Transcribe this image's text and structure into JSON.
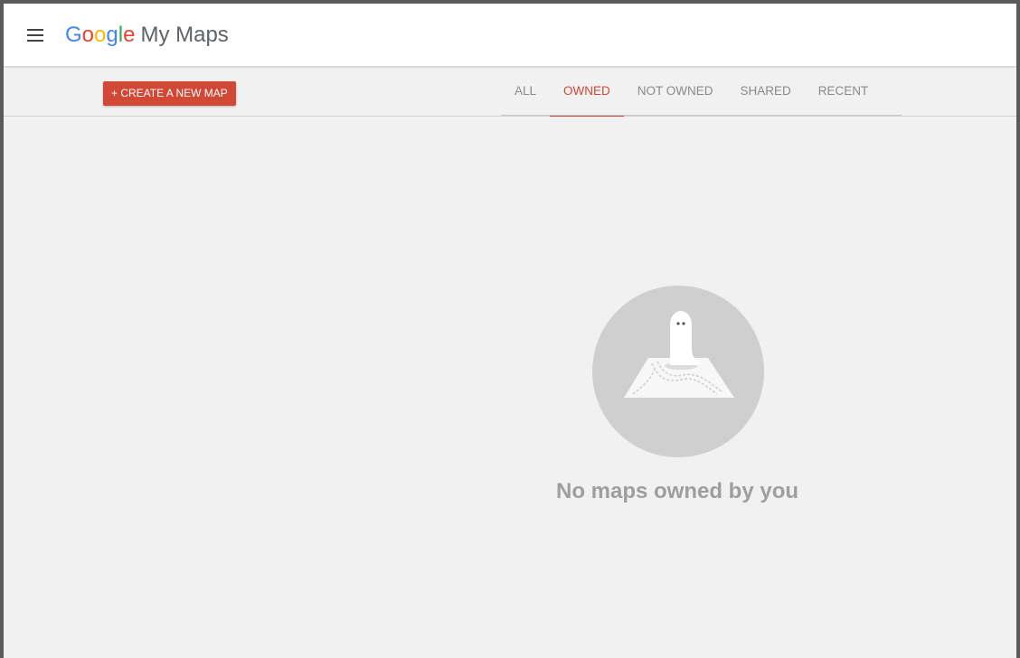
{
  "header": {
    "brand_letters": [
      {
        "char": "G",
        "color": "#4285F4"
      },
      {
        "char": "o",
        "color": "#EA4335"
      },
      {
        "char": "o",
        "color": "#FBBC05"
      },
      {
        "char": "g",
        "color": "#4285F4"
      },
      {
        "char": "l",
        "color": "#34A853"
      },
      {
        "char": "e",
        "color": "#EA4335"
      }
    ],
    "product_name": "My Maps",
    "menu_icon": "hamburger-menu-icon"
  },
  "toolbar": {
    "create_label": "+ CREATE A NEW MAP",
    "accent_color": "#d14836"
  },
  "tabs": [
    {
      "label": "ALL",
      "active": false
    },
    {
      "label": "OWNED",
      "active": true
    },
    {
      "label": "NOT OWNED",
      "active": false
    },
    {
      "label": "SHARED",
      "active": false
    },
    {
      "label": "RECENT",
      "active": false
    }
  ],
  "empty_state": {
    "message": "No maps owned by you",
    "illustration": "ghost-on-map-icon"
  }
}
